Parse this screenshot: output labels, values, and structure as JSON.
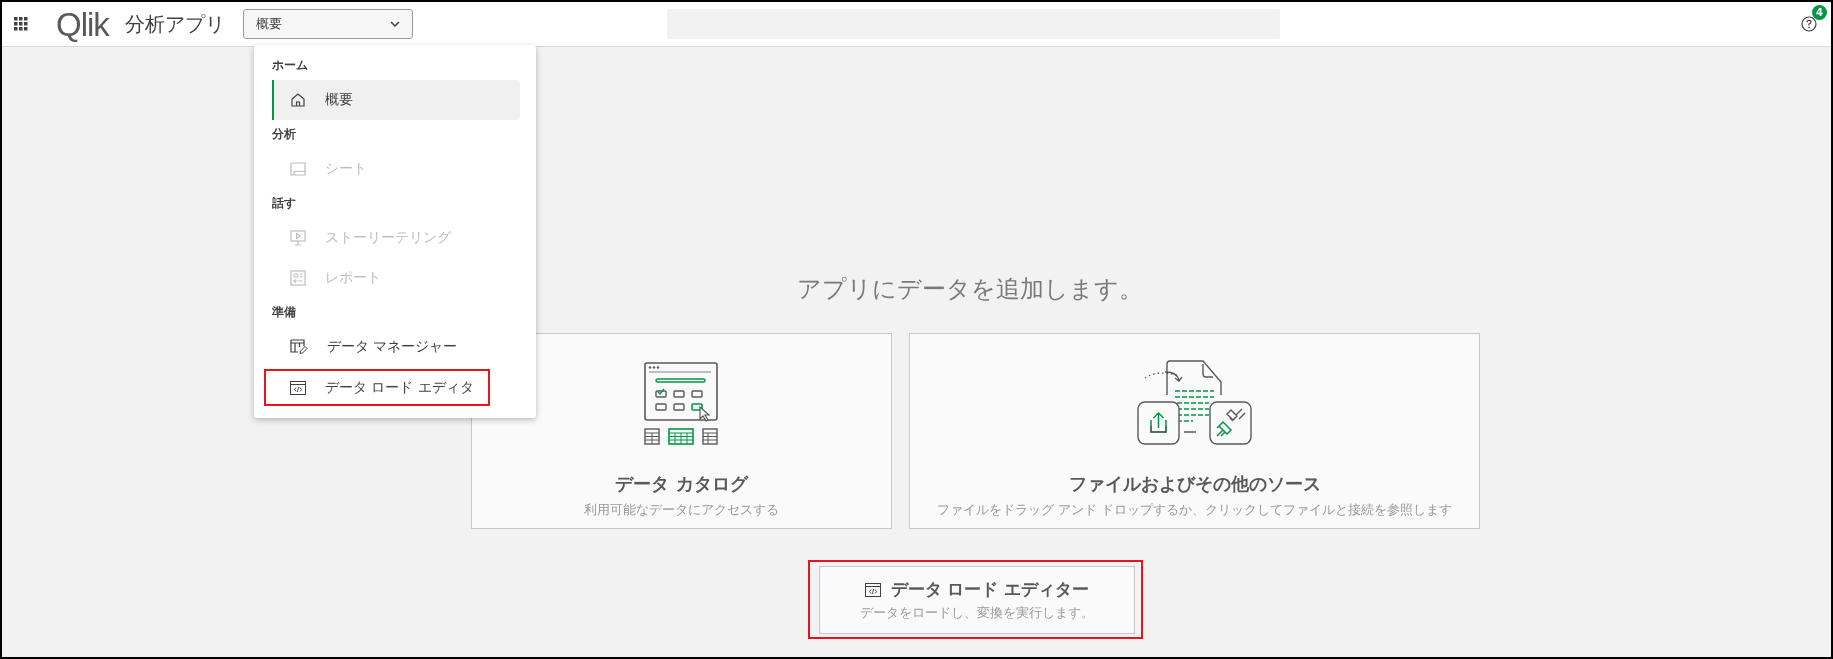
{
  "app_bar": {
    "logo": "Qlik",
    "app_title": "分析アプリ",
    "section_dropdown": {
      "value": "概要",
      "expanded": true
    },
    "help": {
      "badge": "4"
    }
  },
  "menu": {
    "groups": [
      {
        "heading": "ホーム",
        "items": [
          {
            "kind": "home",
            "label": "概要",
            "selected": true,
            "disabled": false,
            "highlighted": false
          }
        ]
      },
      {
        "heading": "分析",
        "items": [
          {
            "kind": "sheet",
            "label": "シート",
            "selected": false,
            "disabled": true,
            "highlighted": false
          }
        ]
      },
      {
        "heading": "話す",
        "items": [
          {
            "kind": "story",
            "label": "ストーリーテリング",
            "selected": false,
            "disabled": true,
            "highlighted": false
          },
          {
            "kind": "report",
            "label": "レポート",
            "selected": false,
            "disabled": true,
            "highlighted": false
          }
        ]
      },
      {
        "heading": "準備",
        "items": [
          {
            "kind": "data_manager",
            "label": "データ マネージャー",
            "selected": false,
            "disabled": false,
            "highlighted": false
          },
          {
            "kind": "load_editor",
            "label": "データ ロード エディタ",
            "selected": false,
            "disabled": false,
            "highlighted": true
          }
        ]
      }
    ]
  },
  "main": {
    "headline": "アプリにデータを追加します。",
    "cards": [
      {
        "kind": "catalog",
        "title": "データ カタログ",
        "description": "利用可能なデータにアクセスする"
      },
      {
        "kind": "files",
        "title": "ファイルおよびその他のソース",
        "description": "ファイルをドラッグ アンド ドロップするか、クリックしてファイルと接続を参照します"
      }
    ],
    "load_editor_button": {
      "title": "データ ロード エディター",
      "description": "データをロードし、変換を実行します。",
      "highlighted": true
    }
  }
}
